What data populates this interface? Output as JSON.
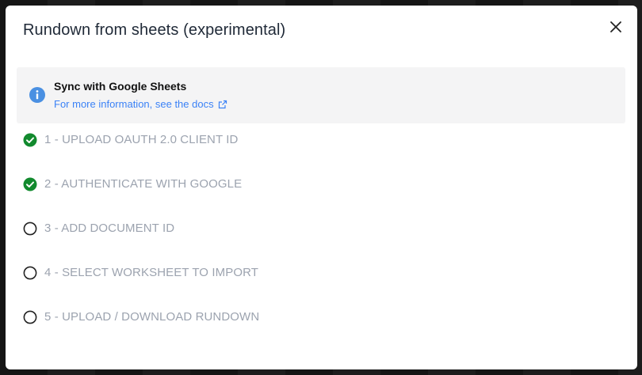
{
  "modal": {
    "title": "Rundown from sheets (experimental)",
    "close_icon": "close-icon"
  },
  "callout": {
    "icon": "info-icon",
    "title": "Sync with Google Sheets",
    "link_text": "For more information, see the docs",
    "link_icon": "external-link-icon"
  },
  "steps": [
    {
      "label": "1 - UPLOAD OAUTH 2.0 CLIENT ID",
      "status": "complete"
    },
    {
      "label": "2 - AUTHENTICATE WITH GOOGLE",
      "status": "complete"
    },
    {
      "label": "3 - ADD DOCUMENT ID",
      "status": "pending"
    },
    {
      "label": "4 - SELECT WORKSHEET TO IMPORT",
      "status": "pending"
    },
    {
      "label": "5 - UPLOAD / DOWNLOAD RUNDOWN",
      "status": "pending"
    }
  ],
  "colors": {
    "complete": "#128a2e",
    "pending": "#222222",
    "link": "#3b82f6",
    "info": "#4a90e2"
  }
}
